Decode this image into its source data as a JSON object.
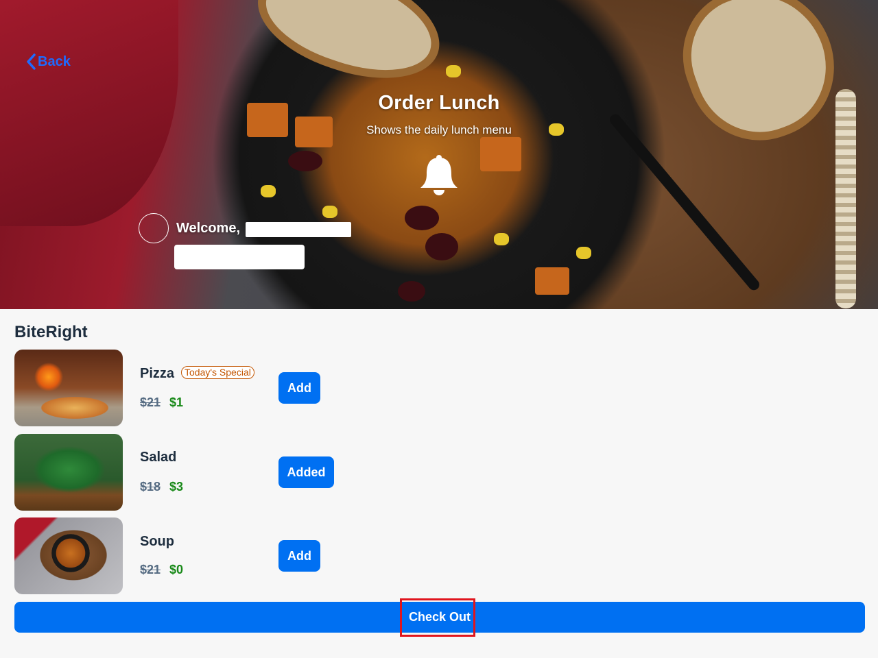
{
  "header": {
    "back_label": "Back",
    "title": "Order Lunch",
    "subtitle": "Shows the daily lunch menu",
    "welcome_label": "Welcome,"
  },
  "menu": {
    "vendor": "BiteRight",
    "items": [
      {
        "name": "Pizza",
        "badge": "Today's Special",
        "old_price": "$21",
        "new_price": "$1",
        "button": "Add"
      },
      {
        "name": "Salad",
        "badge": "",
        "old_price": "$18",
        "new_price": "$3",
        "button": "Added"
      },
      {
        "name": "Soup",
        "badge": "",
        "old_price": "$21",
        "new_price": "$0",
        "button": "Add"
      }
    ]
  },
  "footer": {
    "checkout_label": "Check Out"
  },
  "colors": {
    "primary": "#0070f2",
    "back_link": "#1e6bff",
    "sale_price": "#188918",
    "badge": "#c35500",
    "highlight": "#e0151e"
  },
  "icons": [
    "chevron-left-icon",
    "bell-icon"
  ]
}
